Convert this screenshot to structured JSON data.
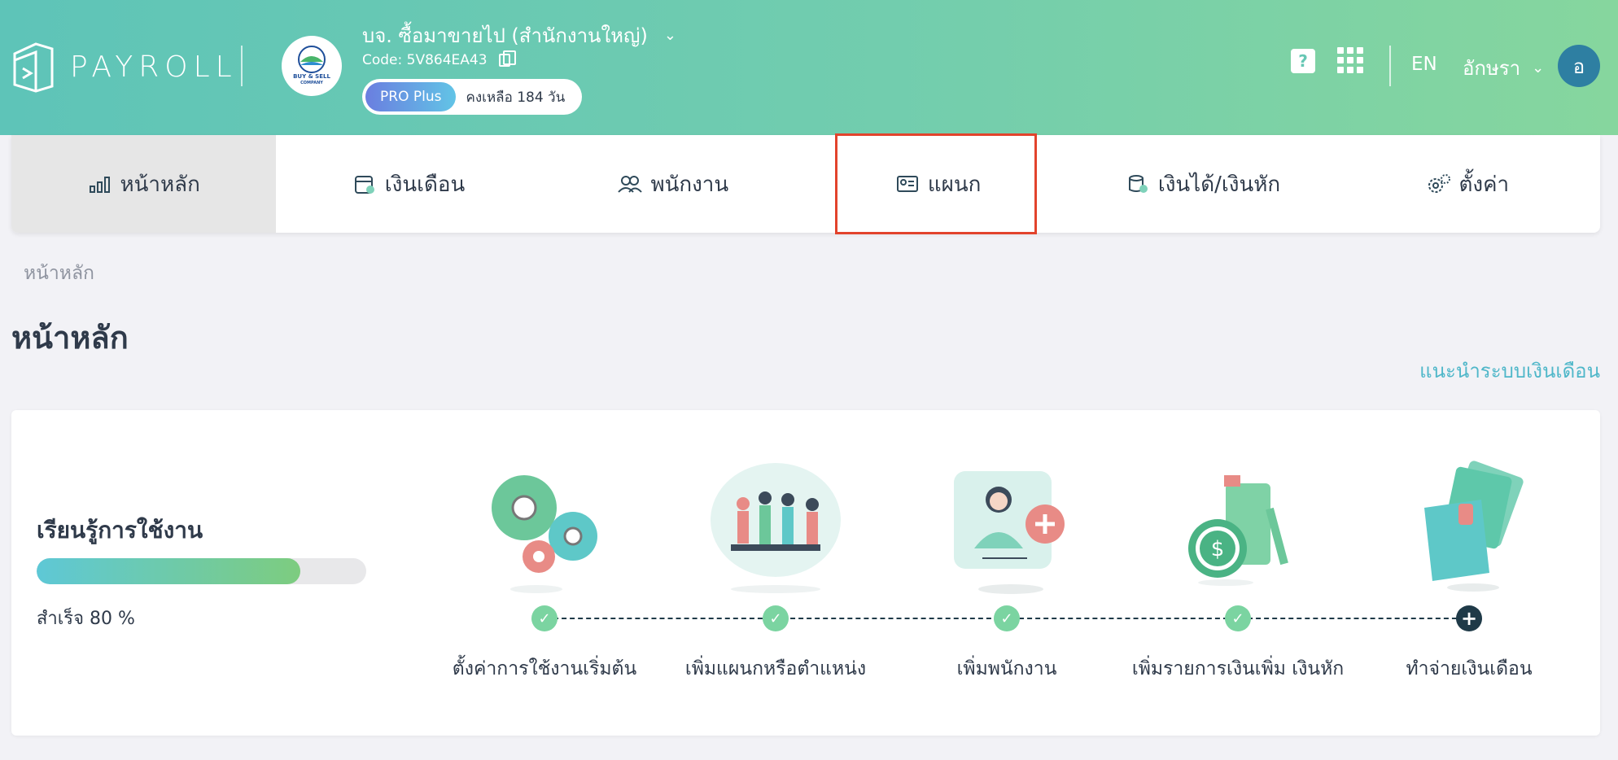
{
  "header": {
    "logo_text": "PAYROLL",
    "company_logo_text": "BUY & SELL",
    "company_logo_sub": "COMPANY",
    "company_name": "บจ. ซื้อมาขายไป (สำนักงานใหญ่)",
    "company_code": "Code: 5V864EA43",
    "plan_badge": "PRO Plus",
    "plan_remaining": "คงเหลือ 184 วัน",
    "help_icon_glyph": "?",
    "language": "EN",
    "user_name": "อักษรา",
    "avatar_initial": "อ"
  },
  "nav": {
    "items": [
      {
        "label": "หน้าหลัก",
        "icon": "bar-chart-icon"
      },
      {
        "label": "เงินเดือน",
        "icon": "calendar-icon"
      },
      {
        "label": "พนักงาน",
        "icon": "people-icon"
      },
      {
        "label": "แผนก",
        "icon": "id-card-icon"
      },
      {
        "label": "เงินได้/เงินหัก",
        "icon": "coins-icon"
      },
      {
        "label": "ตั้งค่า",
        "icon": "gear-icon"
      }
    ],
    "active_index": 0,
    "highlighted_index": 3
  },
  "breadcrumb": "หน้าหลัก",
  "page_title": "หน้าหลัก",
  "guide_link": "แนะนำระบบเงินเดือน",
  "learning": {
    "title": "เรียนรู้การใช้งาน",
    "progress_percent": 80,
    "progress_text": "สำเร็จ 80 %",
    "steps": [
      {
        "label": "ตั้งค่าการใช้งานเริ่มต้น",
        "done": true,
        "icon": "gears-illustration"
      },
      {
        "label": "เพิ่มแผนกหรือตำแหน่ง",
        "done": true,
        "icon": "team-meeting-illustration"
      },
      {
        "label": "เพิ่มพนักงาน",
        "done": true,
        "icon": "add-employee-illustration"
      },
      {
        "label": "เพิ่มรายการเงินเพิ่ม เงินหัก",
        "done": true,
        "icon": "coins-stack-illustration"
      },
      {
        "label": "ทำจ่ายเงินเดือน",
        "done": false,
        "icon": "wallet-illustration"
      }
    ],
    "check_glyph": "✓",
    "pending_glyph": "+"
  },
  "colors": {
    "header_gradient_start": "#5ec4b8",
    "header_gradient_end": "#86d69e",
    "accent": "#4fb7c9",
    "highlight_border": "#e2432c",
    "step_done": "#7bd4a1",
    "step_pending": "#1f3a48"
  }
}
